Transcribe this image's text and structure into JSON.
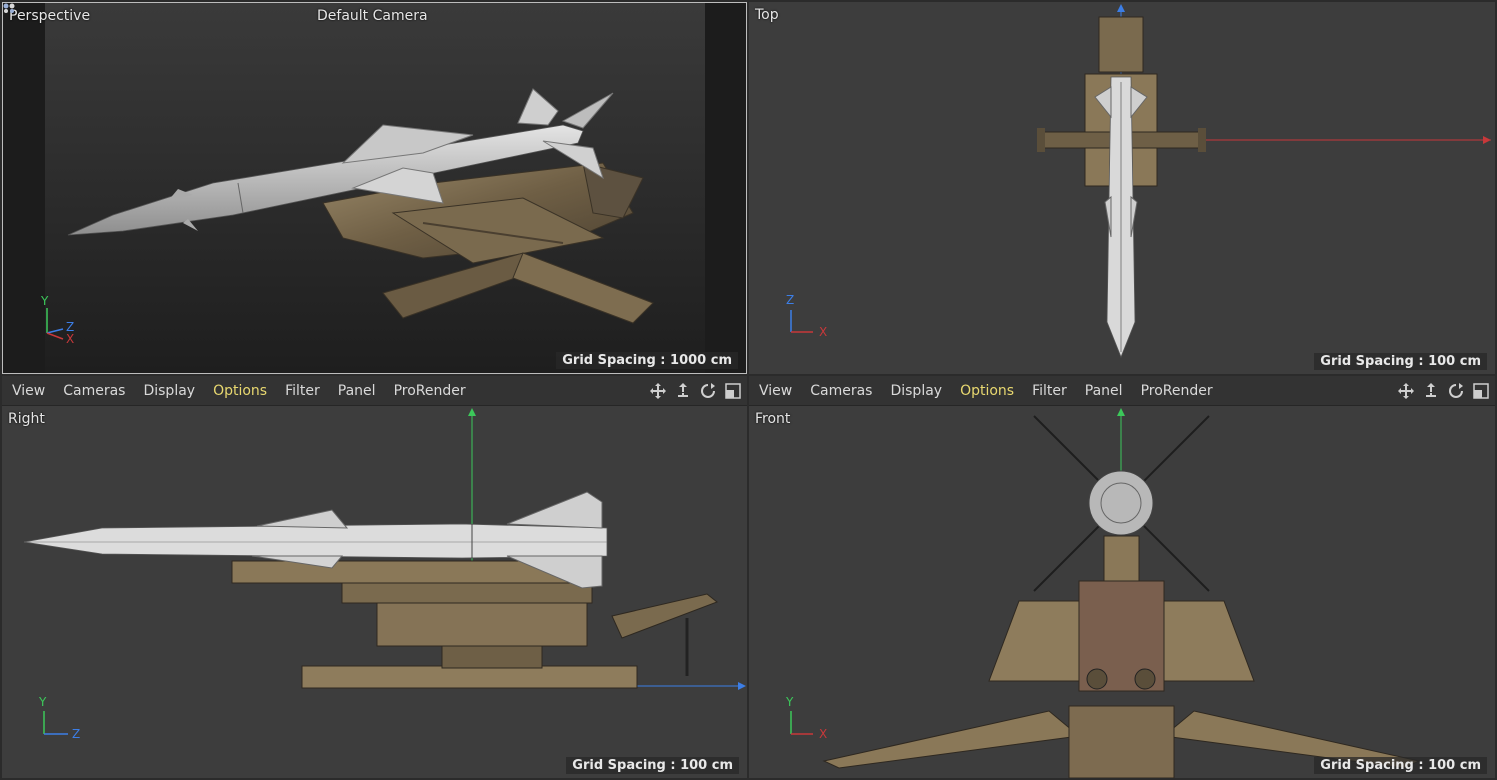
{
  "viewports": {
    "perspective": {
      "label": "Perspective",
      "camera": "Default Camera",
      "grid": "Grid Spacing : 1000 cm",
      "axes": {
        "y": "Y",
        "z": "Z",
        "x": "X"
      }
    },
    "top": {
      "label": "Top",
      "grid": "Grid Spacing : 100 cm",
      "axes": {
        "z": "Z",
        "x": "X"
      }
    },
    "right": {
      "label": "Right",
      "grid": "Grid Spacing : 100 cm",
      "axes": {
        "y": "Y",
        "z": "Z"
      }
    },
    "front": {
      "label": "Front",
      "grid": "Grid Spacing : 100 cm",
      "axes": {
        "y": "Y",
        "x": "X"
      }
    }
  },
  "menus": {
    "left": [
      "View",
      "Cameras",
      "Display",
      "Options",
      "Filter",
      "Panel",
      "ProRender"
    ],
    "right": [
      "View",
      "Cameras",
      "Display",
      "Options",
      "Filter",
      "Panel",
      "ProRender"
    ],
    "active": "Options"
  },
  "nav_icons": [
    "move-view-icon",
    "zoom-view-icon",
    "rotate-view-icon",
    "maximize-view-icon"
  ],
  "colors": {
    "axis_x": "#c8383a",
    "axis_y": "#3cc85a",
    "axis_z": "#3c7ee6",
    "active_menu": "#e8d870",
    "viewport_bg": "#3d3d3d"
  }
}
